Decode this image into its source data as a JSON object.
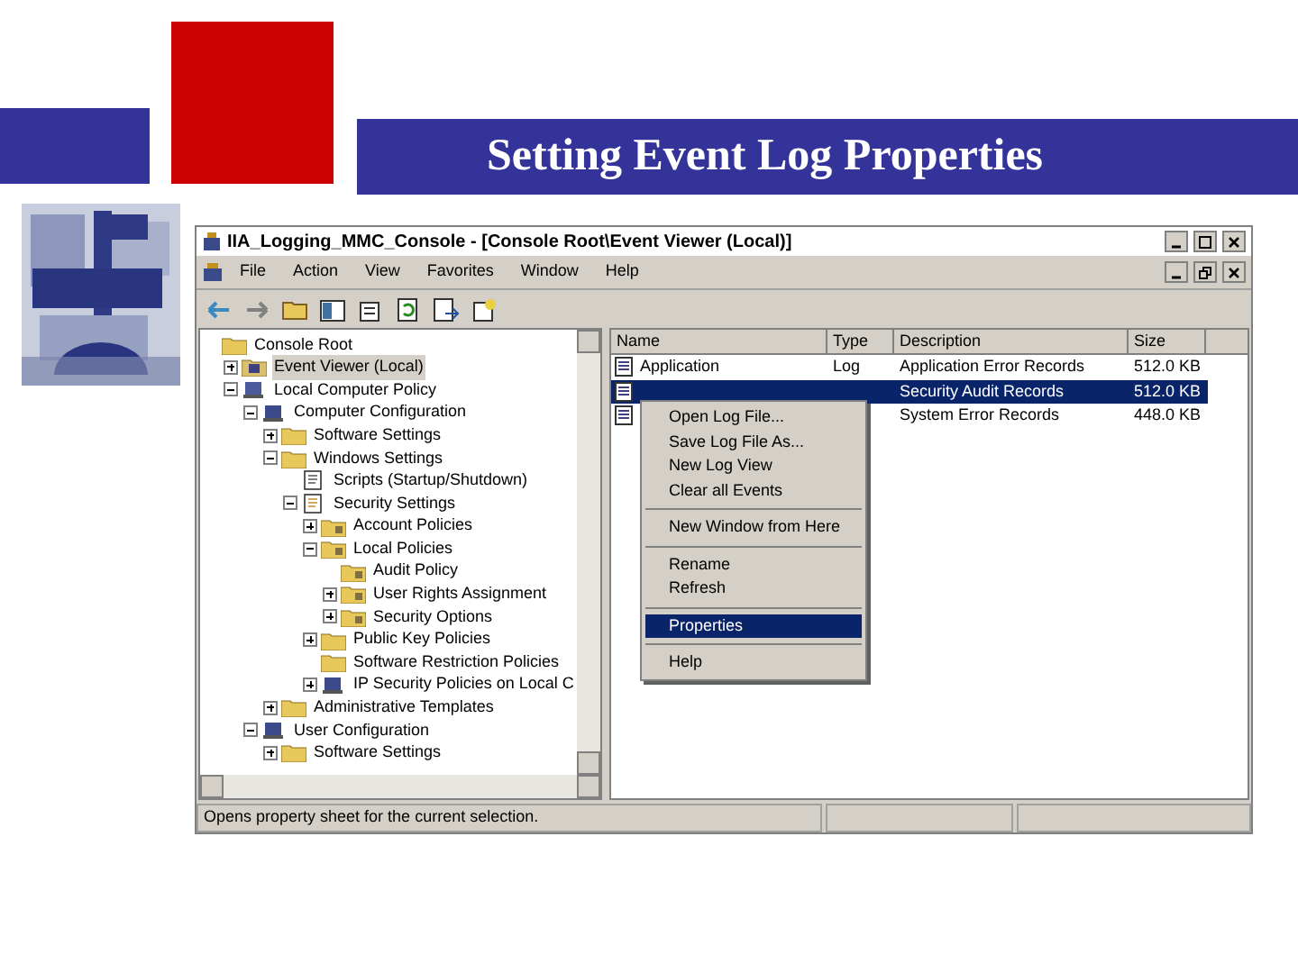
{
  "slide": {
    "title": "Setting Event Log Properties"
  },
  "window": {
    "title": "IIA_Logging_MMC_Console - [Console Root\\Event Viewer (Local)]",
    "menu": [
      "File",
      "Action",
      "View",
      "Favorites",
      "Window",
      "Help"
    ],
    "tree": [
      {
        "label": "Console Root",
        "kind": "folder",
        "selected": false,
        "children": [
          {
            "label": "Event Viewer (Local)",
            "kind": "event",
            "expanded": false,
            "selected": true
          },
          {
            "label": "Local Computer Policy",
            "kind": "policy",
            "expanded": true,
            "selected": false,
            "children": [
              {
                "label": "Computer Configuration",
                "kind": "computer",
                "expanded": true,
                "selected": false,
                "children": [
                  {
                    "label": "Software Settings",
                    "kind": "folder",
                    "expanded": false,
                    "selected": false
                  },
                  {
                    "label": "Windows Settings",
                    "kind": "folder",
                    "expanded": true,
                    "selected": false,
                    "children": [
                      {
                        "label": "Scripts (Startup/Shutdown)",
                        "kind": "script",
                        "selected": false
                      },
                      {
                        "label": "Security Settings",
                        "kind": "secure",
                        "expanded": true,
                        "selected": false,
                        "children": [
                          {
                            "label": "Account Policies",
                            "kind": "lockfolder",
                            "expanded": false,
                            "selected": false
                          },
                          {
                            "label": "Local Policies",
                            "kind": "lockfolder",
                            "expanded": true,
                            "selected": false,
                            "children": [
                              {
                                "label": "Audit Policy",
                                "kind": "lockfolder",
                                "selected": false
                              },
                              {
                                "label": "User Rights Assignment",
                                "kind": "lockfolder",
                                "expanded": false,
                                "selected": false
                              },
                              {
                                "label": "Security Options",
                                "kind": "lockfolder",
                                "expanded": false,
                                "selected": false
                              }
                            ]
                          },
                          {
                            "label": "Public Key Policies",
                            "kind": "folder",
                            "expanded": false,
                            "selected": false
                          },
                          {
                            "label": "Software Restriction Policies",
                            "kind": "folder",
                            "selected": false
                          },
                          {
                            "label": "IP Security Policies on Local C",
                            "kind": "computer",
                            "expanded": false,
                            "selected": false
                          }
                        ]
                      }
                    ]
                  },
                  {
                    "label": "Administrative Templates",
                    "kind": "folder",
                    "expanded": false,
                    "selected": false
                  }
                ]
              },
              {
                "label": "User Configuration",
                "kind": "computer",
                "expanded": true,
                "selected": false,
                "children": [
                  {
                    "label": "Software Settings",
                    "kind": "folder",
                    "expanded": false,
                    "selected": false
                  }
                ]
              }
            ]
          }
        ]
      }
    ],
    "list": {
      "columns": [
        "Name",
        "Type",
        "Description",
        "Size"
      ],
      "rows": [
        {
          "name": "Application",
          "type": "Log",
          "description": "Application Error Records",
          "size": "512.0 KB",
          "selected": false
        },
        {
          "description": "Security Audit Records",
          "size": "512.0 KB",
          "selected": true
        },
        {
          "description": "System Error Records",
          "size": "448.0 KB",
          "selected": false
        }
      ]
    },
    "context_menu": [
      [
        {
          "label": "Open Log File...",
          "selected": false
        },
        {
          "label": "Save Log File As...",
          "selected": false
        },
        {
          "label": "New Log View",
          "selected": false
        },
        {
          "label": "Clear all Events",
          "selected": false
        }
      ],
      [
        {
          "label": "New Window from Here",
          "selected": false
        }
      ],
      [
        {
          "label": "Rename",
          "selected": false
        },
        {
          "label": "Refresh",
          "selected": false
        }
      ],
      [
        {
          "label": "Properties",
          "selected": true
        }
      ],
      [
        {
          "label": "Help",
          "selected": false
        }
      ]
    ],
    "status_bar": "Opens property sheet for the current selection."
  }
}
